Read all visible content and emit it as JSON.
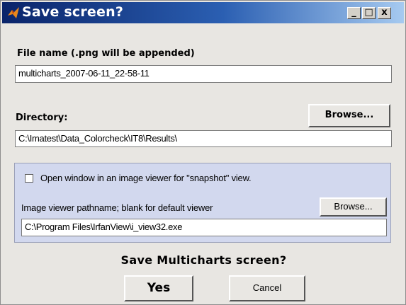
{
  "window": {
    "title": "Save screen?",
    "controls": {
      "minimize": "_",
      "maximize": "□",
      "close": "x"
    }
  },
  "file_name": {
    "label": "File name (.png will be appended)",
    "value": "multicharts_2007-06-11_22-58-11"
  },
  "directory": {
    "label": "Directory:",
    "browse_label": "Browse...",
    "value": "C:\\Imatest\\Data_Colorcheck\\IT8\\Results\\"
  },
  "viewer": {
    "checkbox_label": "Open window in an image viewer for \"snapshot\" view.",
    "checked": false,
    "pathname_label": "Image viewer pathname; blank for default viewer",
    "browse_label": "Browse...",
    "pathname_value": "C:\\Program Files\\IrfanView\\i_view32.exe"
  },
  "prompt": {
    "question": "Save Multicharts screen?",
    "yes_label": "Yes",
    "cancel_label": "Cancel"
  },
  "colors": {
    "title_bar_start": "#0a246a",
    "title_bar_end": "#a6caf0",
    "dialog_background": "#e8e6e2",
    "viewer_panel": "#d2d8ee"
  }
}
